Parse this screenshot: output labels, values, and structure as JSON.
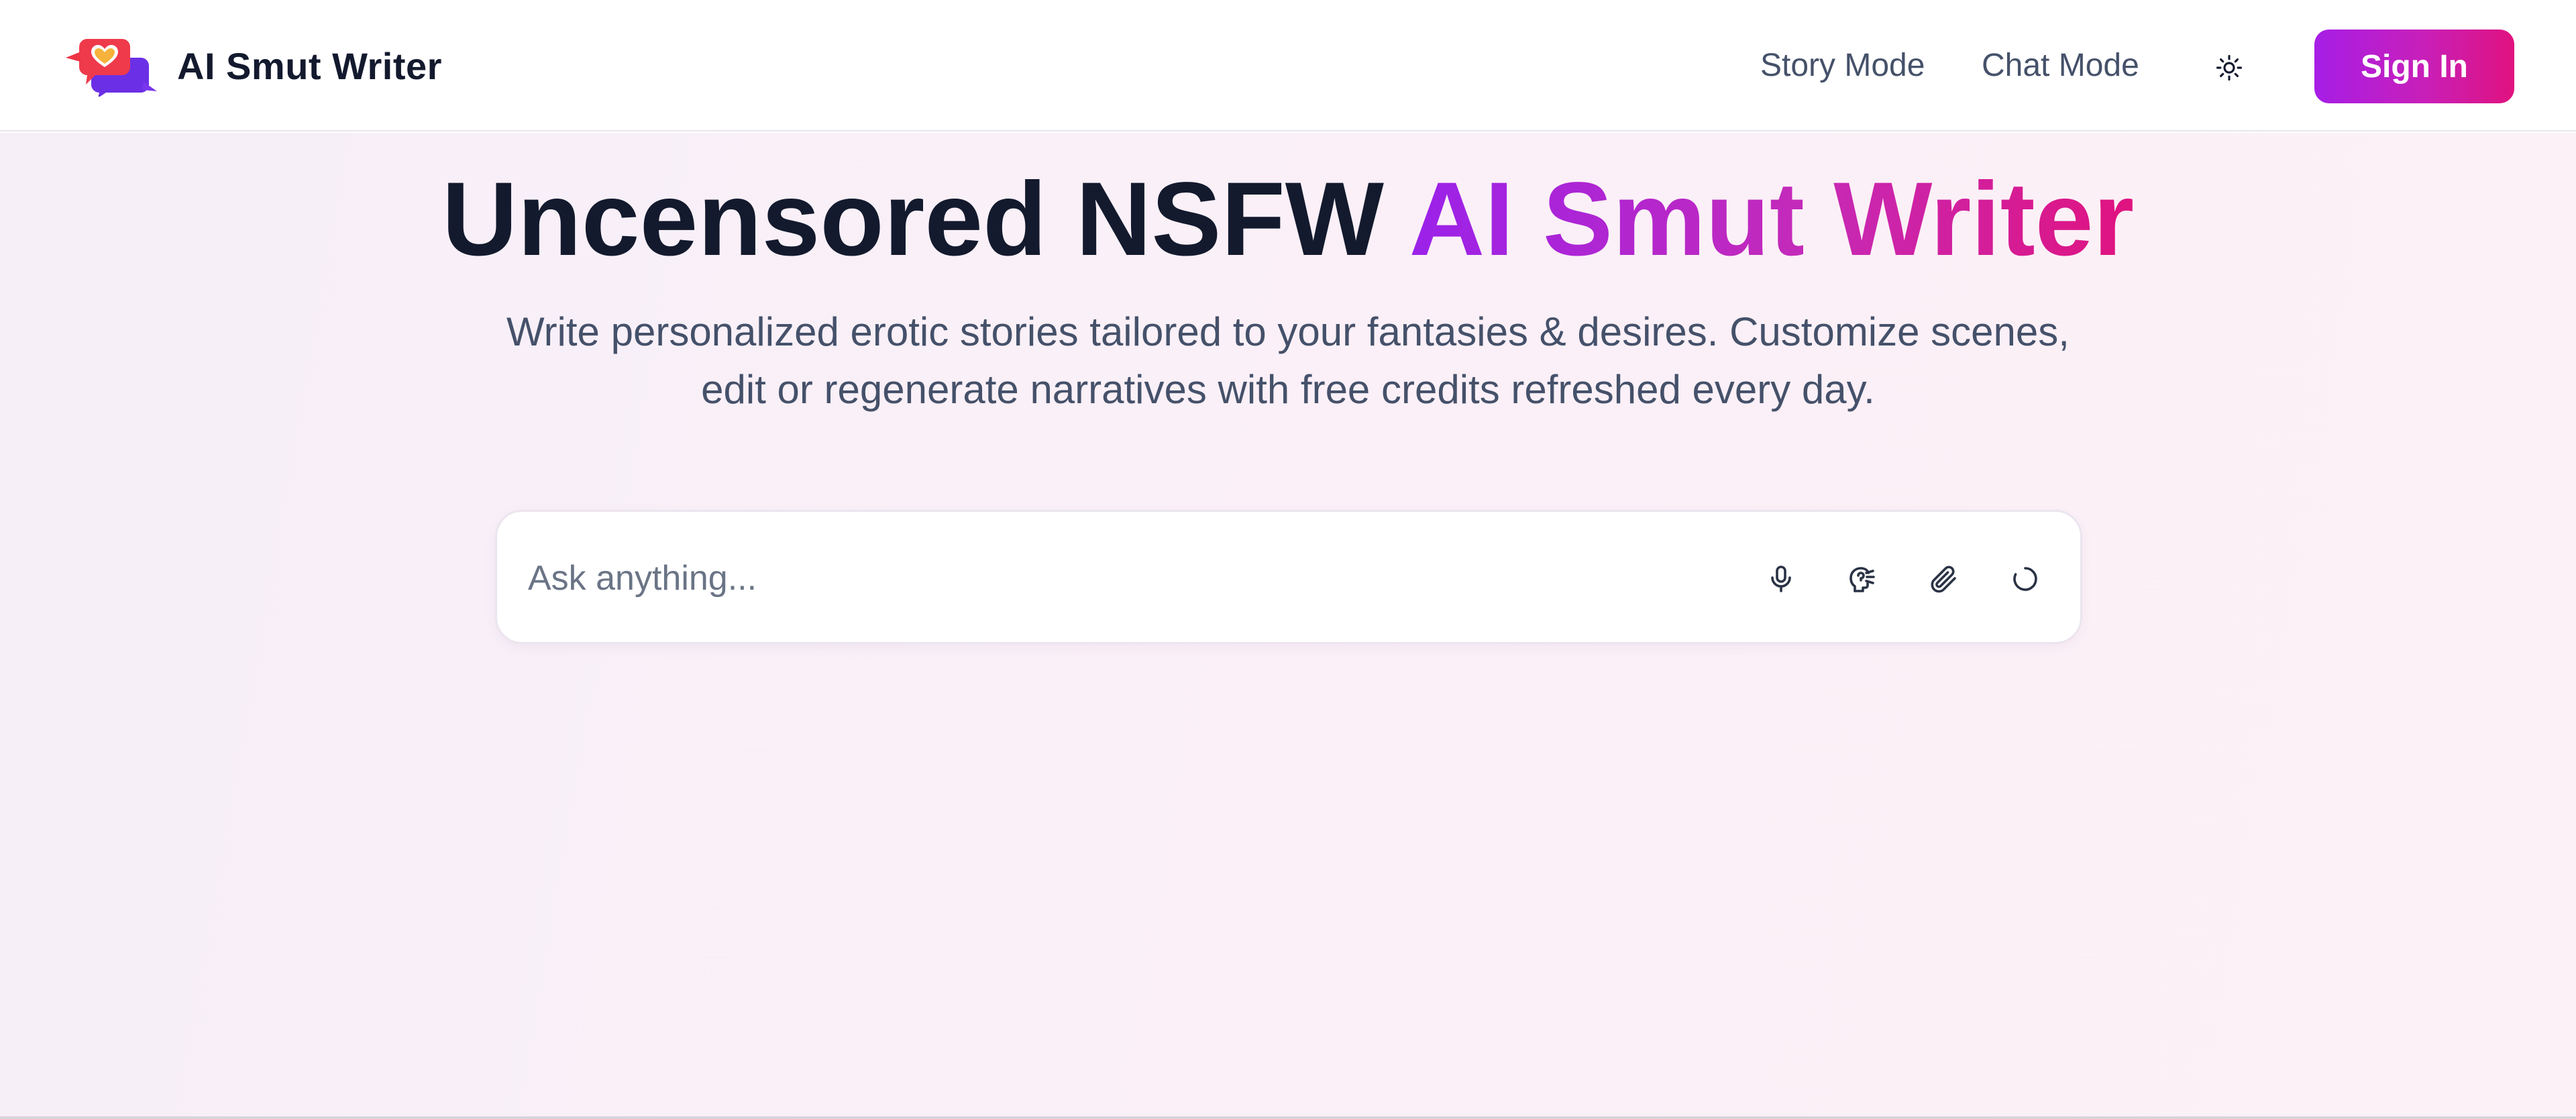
{
  "header": {
    "brand_name": "AI Smut Writer",
    "nav": {
      "story_mode": "Story Mode",
      "chat_mode": "Chat Mode"
    },
    "theme_icon": "sun-icon",
    "sign_in_label": "Sign In"
  },
  "hero": {
    "headline_plain": "Uncensored NSFW",
    "headline_highlight": "AI Smut Writer",
    "subtitle_line1": "Write personalized erotic stories tailored to your fantasies & desires. Customize scenes,",
    "subtitle_line2": "edit or regenerate narratives with free credits refreshed every day."
  },
  "ask": {
    "placeholder": "Ask anything...",
    "value": "",
    "icons": [
      "microphone-icon",
      "voice-mode-icon",
      "paperclip-icon",
      "refresh-icon"
    ]
  },
  "colors": {
    "accent_start": "#9b22ea",
    "accent_mid": "#c52ab8",
    "accent_end": "#e0137f",
    "heading": "#131a2e",
    "body_text": "#45516a"
  }
}
